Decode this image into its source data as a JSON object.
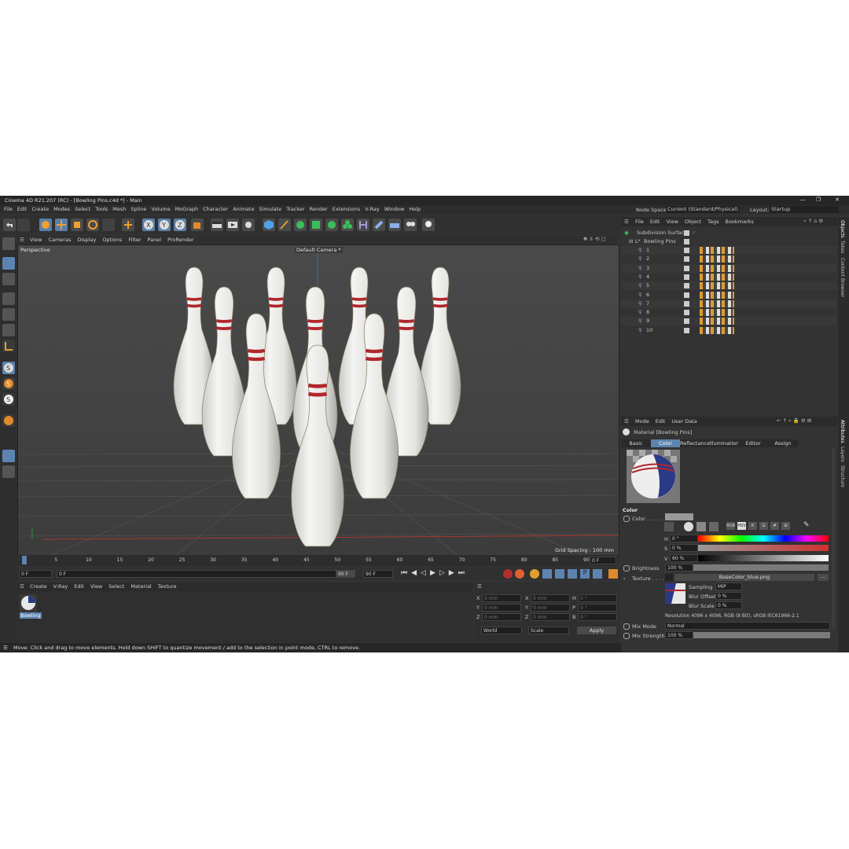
{
  "window": {
    "title": "Cinema 4D R21.207 (RC) - [Bowling Pins.c4d *] - Main",
    "controls": [
      "—",
      "❐",
      "✕"
    ]
  },
  "menubar": {
    "items": [
      "File",
      "Edit",
      "Create",
      "Modes",
      "Select",
      "Tools",
      "Mesh",
      "Spline",
      "Volume",
      "MoGraph",
      "Character",
      "Animate",
      "Simulate",
      "Tracker",
      "Render",
      "Extensions",
      "V-Ray",
      "Window",
      "Help"
    ],
    "node_space_label": "Node Space:",
    "node_space_value": "Current (Standard/Physical)",
    "layout_label": "Layout:",
    "layout_value": "Startup"
  },
  "viewport": {
    "menu": [
      "View",
      "Cameras",
      "Display",
      "Options",
      "Filter",
      "Panel",
      "ProRender"
    ],
    "view_name": "Perspective",
    "camera": "Default Camera *",
    "grid_spacing": "Grid Spacing : 100 mm"
  },
  "timeline": {
    "ticks": [
      "0",
      "5",
      "10",
      "15",
      "20",
      "25",
      "30",
      "35",
      "40",
      "45",
      "50",
      "55",
      "60",
      "65",
      "70",
      "75",
      "80",
      "85",
      "90"
    ],
    "current_frame": "0 F",
    "start_frame": "0 F",
    "start_field": "0 F",
    "end_field": "90 F",
    "end_frame": "90 F"
  },
  "material_manager": {
    "menu": [
      "Create",
      "V-Ray",
      "Edit",
      "View",
      "Select",
      "Material",
      "Texture"
    ],
    "material_name": "Bowling"
  },
  "coordinates": {
    "rows": [
      {
        "a": "X",
        "av": "0 mm",
        "b": "X",
        "bv": "0 mm",
        "c": "H",
        "cv": "0 °"
      },
      {
        "a": "Y",
        "av": "0 mm",
        "b": "Y",
        "bv": "0 mm",
        "c": "P",
        "cv": "0 °"
      },
      {
        "a": "Z",
        "av": "0 mm",
        "b": "Z",
        "bv": "0 mm",
        "c": "B",
        "cv": "0 °"
      }
    ],
    "mode1": "World",
    "mode2": "Scale",
    "apply": "Apply"
  },
  "status": "Move: Click and drag to move elements. Hold down SHIFT to quantize movement / add to the selection in point mode, CTRL to remove.",
  "object_manager": {
    "menu": [
      "File",
      "Edit",
      "View",
      "Object",
      "Tags",
      "Bookmarks"
    ],
    "root": "Subdivision Surface",
    "group": "Bowling Pins",
    "children": [
      "1",
      "2",
      "3",
      "4",
      "5",
      "6",
      "7",
      "8",
      "9",
      "10"
    ]
  },
  "attributes": {
    "menu": [
      "Mode",
      "Edit",
      "User Data"
    ],
    "header": "Material [Bowling Pins]",
    "tabs": [
      "Basic",
      "Color",
      "Reflectance",
      "Illumination",
      "Editor",
      "Assign"
    ],
    "section": "Color",
    "color_label": "Color . . . . .",
    "h_label": "H",
    "h_value": "0 °",
    "s_label": "S",
    "s_value": "0 %",
    "v_label": "V",
    "v_value": "60 %",
    "brightness_label": "Brightness",
    "brightness_value": "100 %",
    "texture_label": "Texture . . . .",
    "texture_file": "BaseColor_blue.png",
    "texture_more": "...",
    "sampling_label": "Sampling",
    "sampling_value": "MIP",
    "blur_offset_label": "Blur Offset",
    "blur_offset_value": "0 %",
    "blur_scale_label": "Blur Scale",
    "blur_scale_value": "0 %",
    "resolution": "Resolution 4096 x 4096, RGB (8 Bit), sRGB IEC61966-2.1",
    "mix_mode_label": "Mix Mode",
    "mix_mode_value": "Normal",
    "mix_strength_label": "Mix Strength",
    "mix_strength_value": "100 %",
    "color_mode_buttons": [
      "RGB",
      "HSV",
      "K",
      "☰",
      "#",
      "⊞"
    ]
  },
  "right_tabs": {
    "top": [
      "Objects",
      "Takes",
      "Content Browser"
    ],
    "bottom": [
      "Attributes",
      "Layers",
      "Structure"
    ]
  },
  "colors": {
    "selected_tab": "#5d84b0",
    "stripe": "#b0272b",
    "pin": "#ececea"
  }
}
